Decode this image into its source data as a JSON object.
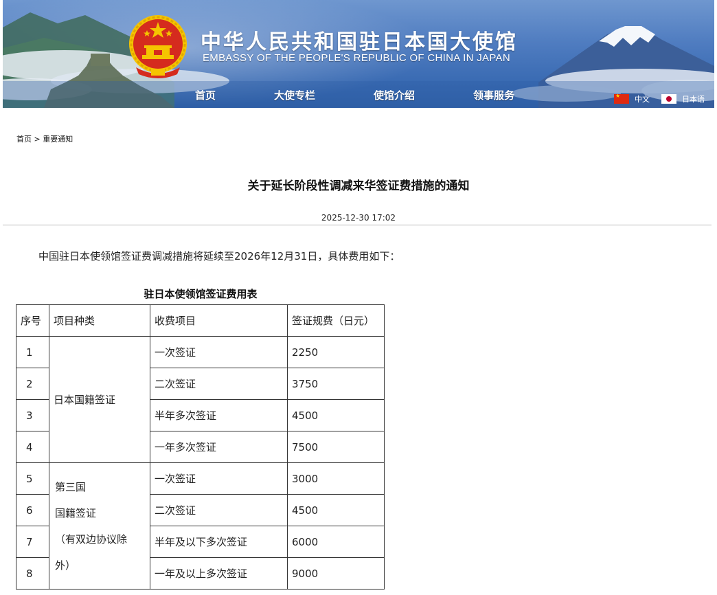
{
  "header": {
    "title": "中华人民共和国驻日本国大使馆",
    "subtitle": "EMBASSY OF THE PEOPLE'S REPUBLIC OF CHINA IN JAPAN",
    "nav": [
      "首页",
      "大使专栏",
      "使馆介绍",
      "领事服务"
    ],
    "languages": [
      {
        "label": "中文",
        "flag": "china-flag-icon"
      },
      {
        "label": "日本语",
        "flag": "japan-flag-icon"
      }
    ]
  },
  "breadcrumb": {
    "home": "首页",
    "separator": ">",
    "current": "重要通知"
  },
  "article": {
    "title": "关于延长阶段性调减来华签证费措施的通知",
    "date": "2025-12-30 17:02",
    "intro": "中国驻日本使领馆签证费调减措施将延续至2026年12月31日，具体费用如下："
  },
  "fee_table": {
    "caption": "驻日本使领馆签证费用表",
    "headers": [
      "序号",
      "项目种类",
      "收费项目",
      "签证规费（日元）"
    ],
    "groups": [
      {
        "category_lines": [
          "日本国籍签证"
        ],
        "rows": [
          {
            "no": "1",
            "item": "一次签证",
            "fee": "2250"
          },
          {
            "no": "2",
            "item": "二次签证",
            "fee": "3750"
          },
          {
            "no": "3",
            "item": "半年多次签证",
            "fee": "4500"
          },
          {
            "no": "4",
            "item": "一年多次签证",
            "fee": "7500"
          }
        ]
      },
      {
        "category_lines": [
          "第三国",
          "国籍签证",
          "（有双边协议除",
          "外）"
        ],
        "rows": [
          {
            "no": "5",
            "item": "一次签证",
            "fee": "3000"
          },
          {
            "no": "6",
            "item": "二次签证",
            "fee": "4500"
          },
          {
            "no": "7",
            "item": "半年及以下多次签证",
            "fee": "6000"
          },
          {
            "no": "8",
            "item": "一年及以上多次签证",
            "fee": "9000"
          }
        ]
      }
    ]
  },
  "colors": {
    "banner_blue": "#3a6bb3",
    "emblem_red": "#d52b1e",
    "emblem_gold": "#f5c400"
  }
}
